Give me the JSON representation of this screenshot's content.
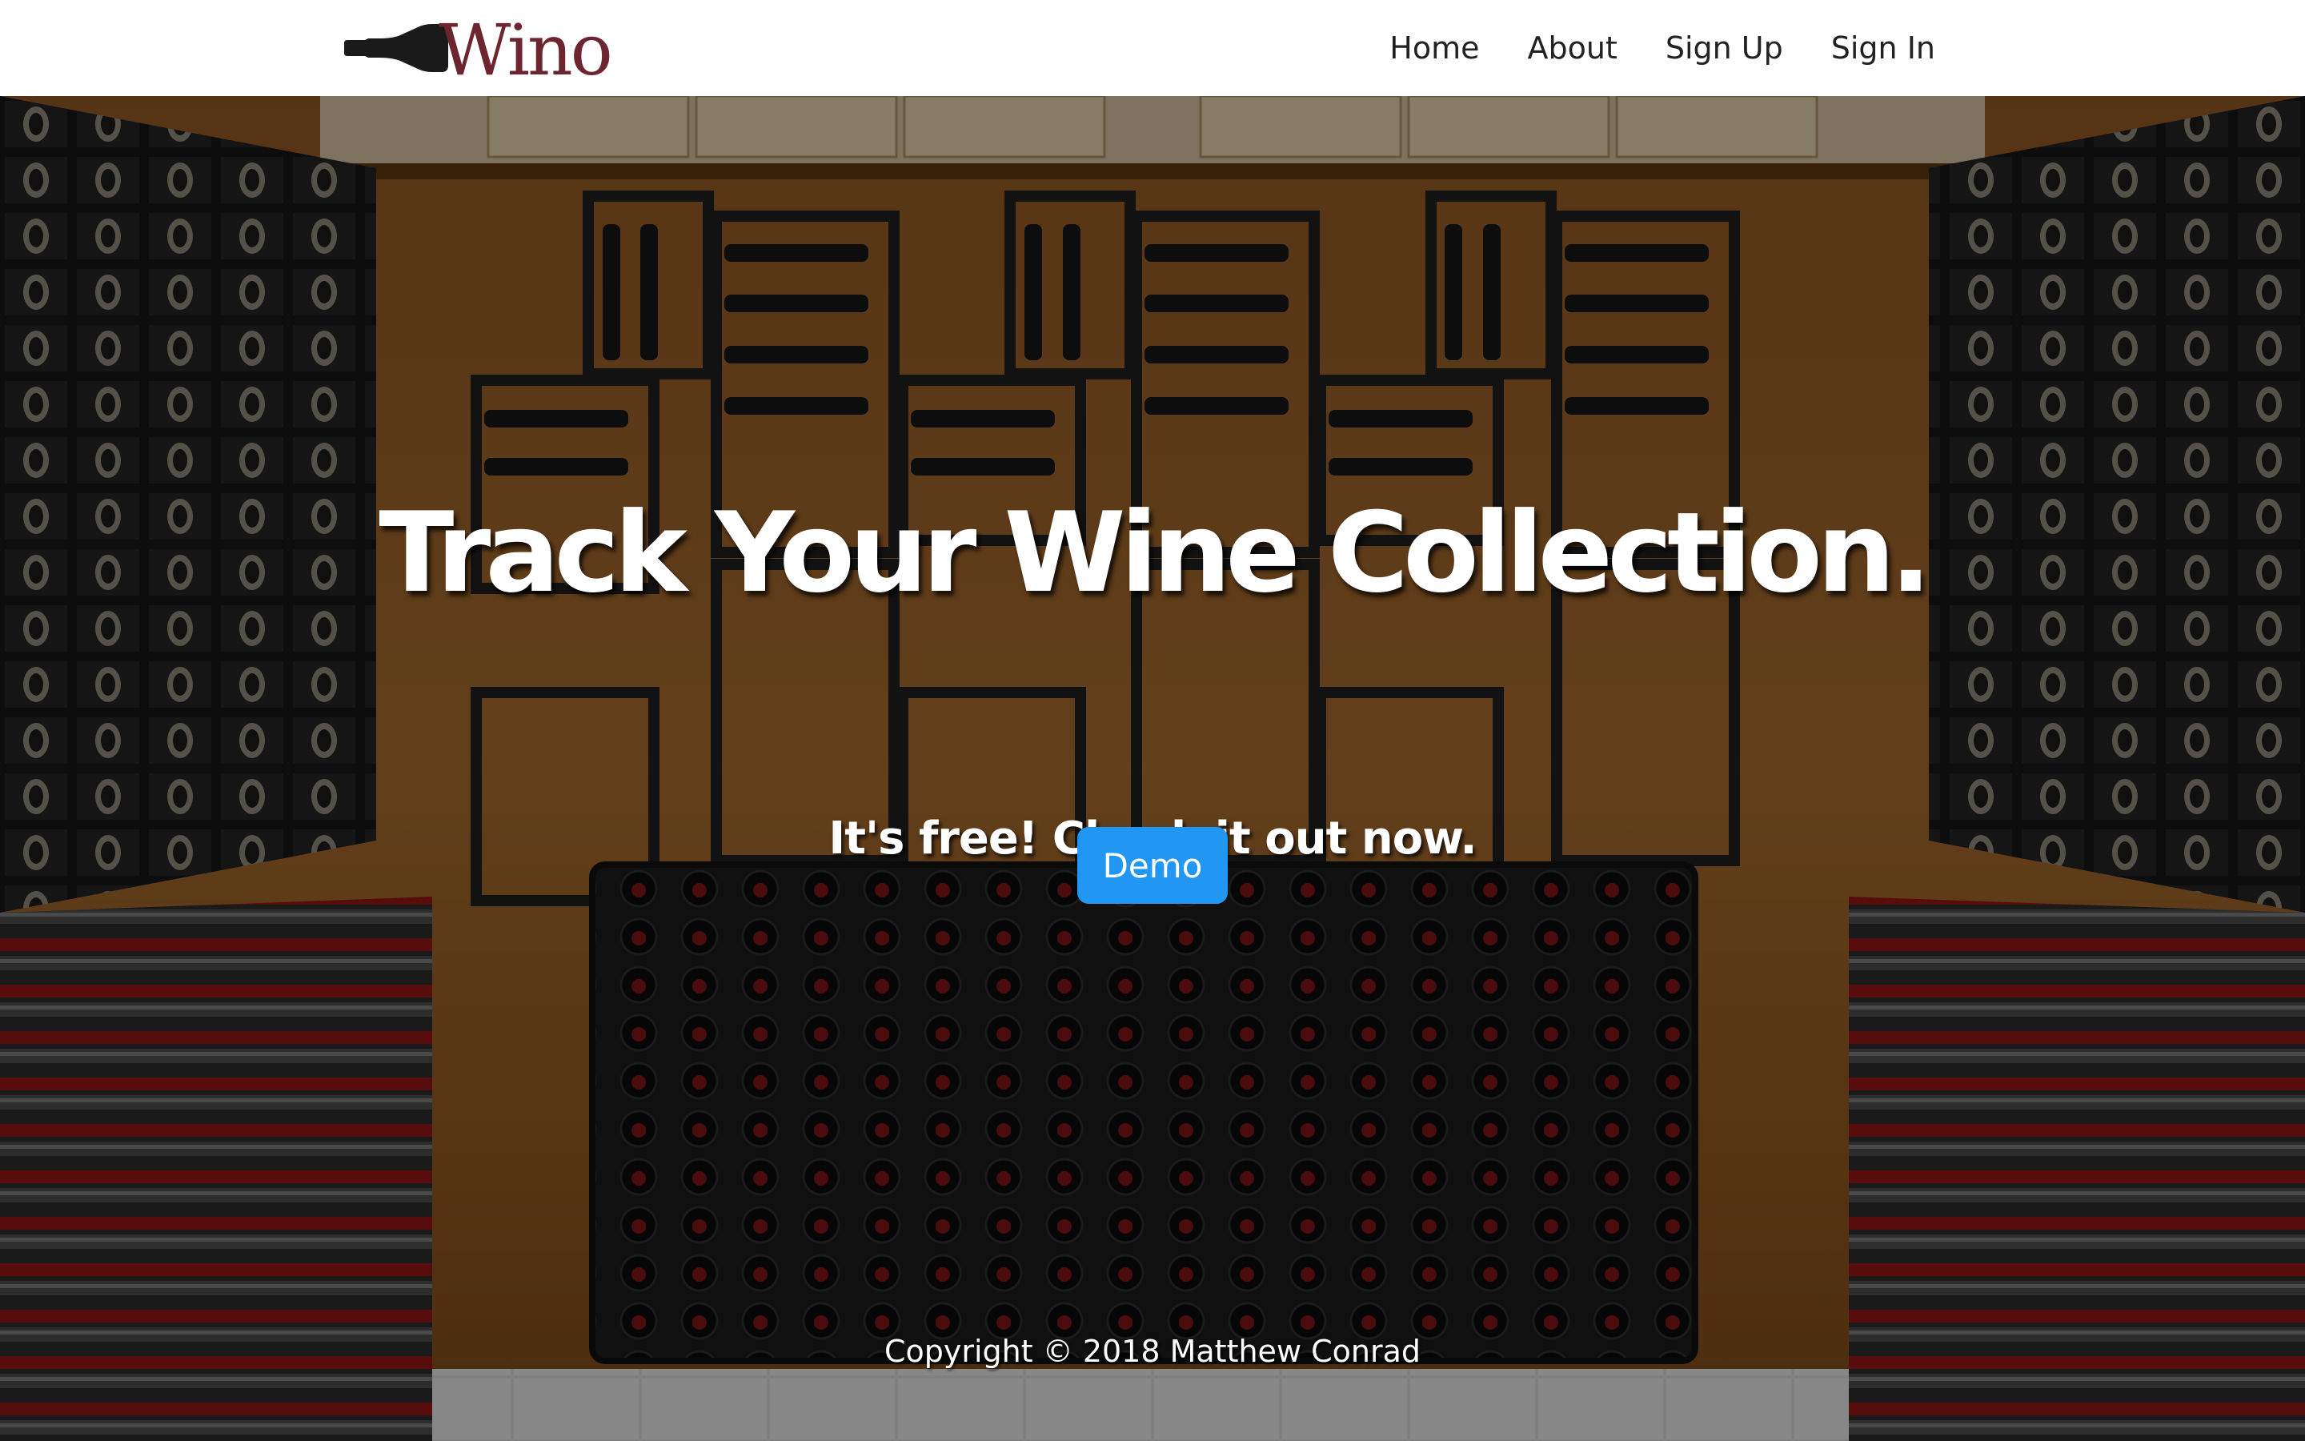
{
  "brand": {
    "logo_text": "Wino",
    "logo_icon": "wine-bottle-icon",
    "logo_color": "#6d2530"
  },
  "nav": {
    "links": [
      {
        "label": "Home"
      },
      {
        "label": "About"
      },
      {
        "label": "Sign Up"
      },
      {
        "label": "Sign In"
      }
    ]
  },
  "hero": {
    "headline": "Track Your Wine Collection.",
    "subheadline": "It's free! Check it out now.",
    "cta_label": "Demo",
    "cta_color": "#2196f3",
    "background": "wine-cellar-photo"
  },
  "footer": {
    "copyright": "Copyright © 2018 Matthew Conrad"
  }
}
